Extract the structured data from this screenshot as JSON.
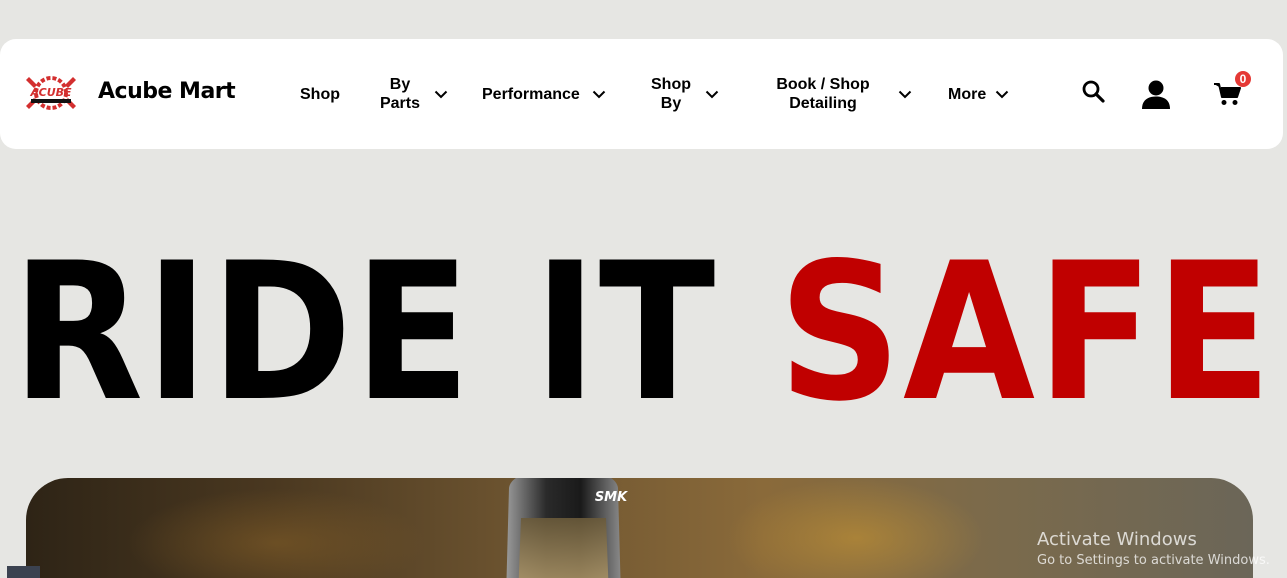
{
  "brand": {
    "logo_text": "ACUBE",
    "name": "Acube Mart"
  },
  "nav": {
    "shop": "Shop",
    "by_parts": "By Parts",
    "performance": "Performance",
    "shop_by": "Shop By",
    "book_shop_detailing": "Book / Shop Detailing",
    "more": "More"
  },
  "icons": {
    "search": "search-icon",
    "account": "user-icon",
    "cart": "cart-icon",
    "chevron": "chevron-down-icon"
  },
  "cart": {
    "count": "0"
  },
  "hero": {
    "title_part1": "RIDE IT ",
    "title_part2": "SAFE",
    "helmet_brand": "SMK"
  },
  "colors": {
    "background": "#e6e6e3",
    "accent_red": "#c00000",
    "badge_red": "#e53935",
    "text": "#000000"
  },
  "overlay": {
    "activate_title": "Activate Windows",
    "activate_subtitle": "Go to Settings to activate Windows."
  }
}
